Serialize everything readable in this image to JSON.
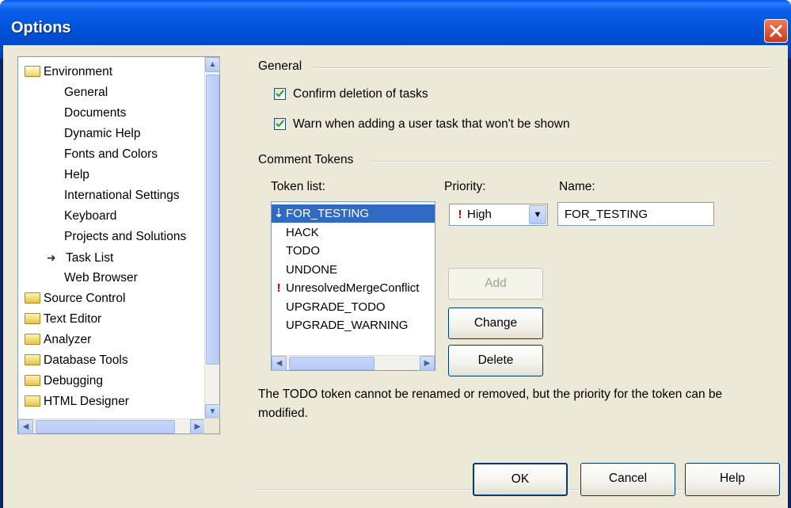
{
  "window": {
    "title": "Options"
  },
  "tree": {
    "items": [
      {
        "label": "Environment",
        "type": "folder-open",
        "indent": 0
      },
      {
        "label": "General",
        "type": "leaf",
        "indent": 1
      },
      {
        "label": "Documents",
        "type": "leaf",
        "indent": 1
      },
      {
        "label": "Dynamic Help",
        "type": "leaf",
        "indent": 1
      },
      {
        "label": "Fonts and Colors",
        "type": "leaf",
        "indent": 1
      },
      {
        "label": "Help",
        "type": "leaf",
        "indent": 1
      },
      {
        "label": "International Settings",
        "type": "leaf",
        "indent": 1
      },
      {
        "label": "Keyboard",
        "type": "leaf",
        "indent": 1
      },
      {
        "label": "Projects and Solutions",
        "type": "leaf",
        "indent": 1
      },
      {
        "label": "Task List",
        "type": "leaf-current",
        "indent": 1
      },
      {
        "label": "Web Browser",
        "type": "leaf",
        "indent": 1
      },
      {
        "label": "Source Control",
        "type": "folder",
        "indent": 0
      },
      {
        "label": "Text Editor",
        "type": "folder",
        "indent": 0
      },
      {
        "label": "Analyzer",
        "type": "folder",
        "indent": 0
      },
      {
        "label": "Database Tools",
        "type": "folder",
        "indent": 0
      },
      {
        "label": "Debugging",
        "type": "folder",
        "indent": 0
      },
      {
        "label": "HTML Designer",
        "type": "folder",
        "indent": 0
      }
    ]
  },
  "general": {
    "heading": "General",
    "confirm_deletion": {
      "label": "Confirm deletion of tasks",
      "checked": true
    },
    "warn_user_task": {
      "label": "Warn when adding a user task that won't be shown",
      "checked": true
    }
  },
  "tokens": {
    "heading": "Comment Tokens",
    "list_label": "Token list:",
    "priority_label": "Priority:",
    "name_label": "Name:",
    "items": [
      {
        "label": "FOR_TESTING",
        "priority": "low",
        "selected": true
      },
      {
        "label": "HACK",
        "priority": "",
        "selected": false
      },
      {
        "label": "TODO",
        "priority": "",
        "selected": false
      },
      {
        "label": "UNDONE",
        "priority": "",
        "selected": false
      },
      {
        "label": "UnresolvedMergeConflict",
        "priority": "high",
        "selected": false
      },
      {
        "label": "UPGRADE_TODO",
        "priority": "",
        "selected": false
      },
      {
        "label": "UPGRADE_WARNING",
        "priority": "",
        "selected": false
      }
    ],
    "priority_value": "High",
    "name_value": "FOR_TESTING",
    "add_label": "Add",
    "change_label": "Change",
    "delete_label": "Delete",
    "note": "The TODO token cannot be renamed or removed, but the priority for the token can be modified."
  },
  "footer": {
    "ok_label": "OK",
    "cancel_label": "Cancel",
    "help_label": "Help"
  },
  "colors": {
    "selection": "#316ac5",
    "title_bar": "#0052d8",
    "dialog": "#ece9d8"
  }
}
